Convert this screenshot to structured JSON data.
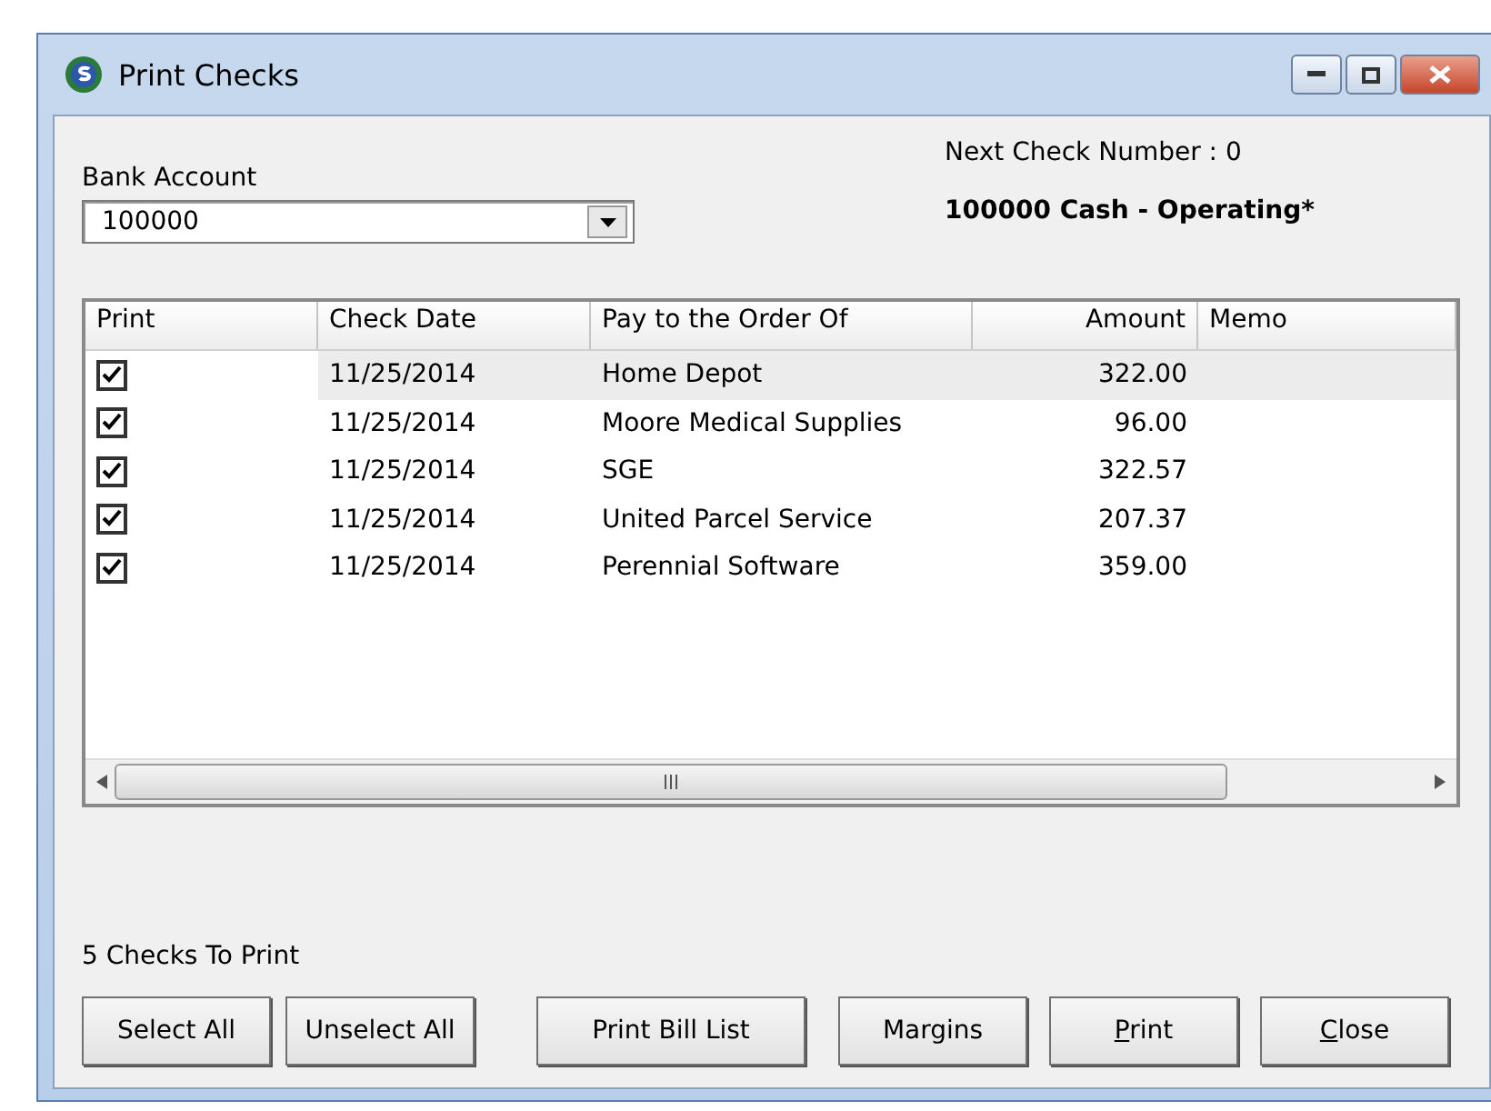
{
  "window": {
    "title": "Print Checks"
  },
  "bank_account": {
    "label": "Bank Account",
    "value": "100000"
  },
  "next_check_number": "Next Check Number : 0",
  "account_name": "100000 Cash - Operating*",
  "table": {
    "columns": [
      {
        "label": "Print"
      },
      {
        "label": "Check Date"
      },
      {
        "label": "Pay to the Order Of"
      },
      {
        "label": "Amount"
      },
      {
        "label": "Memo"
      }
    ],
    "rows": [
      {
        "checked": true,
        "selected": true,
        "date": "11/25/2014",
        "payee": "Home Depot",
        "amount": "322.00"
      },
      {
        "checked": true,
        "selected": false,
        "date": "11/25/2014",
        "payee": "Moore Medical Supplies",
        "amount": "96.00"
      },
      {
        "checked": true,
        "selected": false,
        "date": "11/25/2014",
        "payee": "SGE",
        "amount": "322.57"
      },
      {
        "checked": true,
        "selected": false,
        "date": "11/25/2014",
        "payee": "United Parcel Service",
        "amount": "207.37"
      },
      {
        "checked": true,
        "selected": false,
        "date": "11/25/2014",
        "payee": "Perennial Software",
        "amount": "359.00"
      }
    ]
  },
  "status": "5 Checks To Print",
  "buttons": [
    {
      "label": "Select All",
      "mnemonic": false
    },
    {
      "label": "Unselect All",
      "mnemonic": false
    },
    {
      "label": "Print Bill List",
      "mnemonic": false
    },
    {
      "label": "Margins",
      "mnemonic": false
    },
    {
      "label": "Print",
      "mnemonic": true
    },
    {
      "label": "Close",
      "mnemonic": true
    }
  ]
}
